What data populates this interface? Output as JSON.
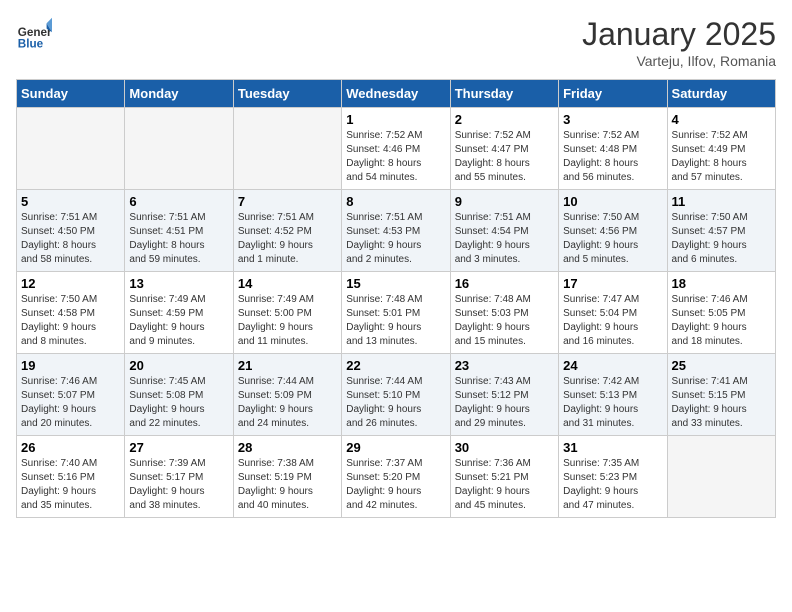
{
  "header": {
    "logo_line1": "General",
    "logo_line2": "Blue",
    "month": "January 2025",
    "location": "Varteju, Ilfov, Romania"
  },
  "weekdays": [
    "Sunday",
    "Monday",
    "Tuesday",
    "Wednesday",
    "Thursday",
    "Friday",
    "Saturday"
  ],
  "weeks": [
    [
      {
        "day": "",
        "info": ""
      },
      {
        "day": "",
        "info": ""
      },
      {
        "day": "",
        "info": ""
      },
      {
        "day": "1",
        "info": "Sunrise: 7:52 AM\nSunset: 4:46 PM\nDaylight: 8 hours\nand 54 minutes."
      },
      {
        "day": "2",
        "info": "Sunrise: 7:52 AM\nSunset: 4:47 PM\nDaylight: 8 hours\nand 55 minutes."
      },
      {
        "day": "3",
        "info": "Sunrise: 7:52 AM\nSunset: 4:48 PM\nDaylight: 8 hours\nand 56 minutes."
      },
      {
        "day": "4",
        "info": "Sunrise: 7:52 AM\nSunset: 4:49 PM\nDaylight: 8 hours\nand 57 minutes."
      }
    ],
    [
      {
        "day": "5",
        "info": "Sunrise: 7:51 AM\nSunset: 4:50 PM\nDaylight: 8 hours\nand 58 minutes."
      },
      {
        "day": "6",
        "info": "Sunrise: 7:51 AM\nSunset: 4:51 PM\nDaylight: 8 hours\nand 59 minutes."
      },
      {
        "day": "7",
        "info": "Sunrise: 7:51 AM\nSunset: 4:52 PM\nDaylight: 9 hours\nand 1 minute."
      },
      {
        "day": "8",
        "info": "Sunrise: 7:51 AM\nSunset: 4:53 PM\nDaylight: 9 hours\nand 2 minutes."
      },
      {
        "day": "9",
        "info": "Sunrise: 7:51 AM\nSunset: 4:54 PM\nDaylight: 9 hours\nand 3 minutes."
      },
      {
        "day": "10",
        "info": "Sunrise: 7:50 AM\nSunset: 4:56 PM\nDaylight: 9 hours\nand 5 minutes."
      },
      {
        "day": "11",
        "info": "Sunrise: 7:50 AM\nSunset: 4:57 PM\nDaylight: 9 hours\nand 6 minutes."
      }
    ],
    [
      {
        "day": "12",
        "info": "Sunrise: 7:50 AM\nSunset: 4:58 PM\nDaylight: 9 hours\nand 8 minutes."
      },
      {
        "day": "13",
        "info": "Sunrise: 7:49 AM\nSunset: 4:59 PM\nDaylight: 9 hours\nand 9 minutes."
      },
      {
        "day": "14",
        "info": "Sunrise: 7:49 AM\nSunset: 5:00 PM\nDaylight: 9 hours\nand 11 minutes."
      },
      {
        "day": "15",
        "info": "Sunrise: 7:48 AM\nSunset: 5:01 PM\nDaylight: 9 hours\nand 13 minutes."
      },
      {
        "day": "16",
        "info": "Sunrise: 7:48 AM\nSunset: 5:03 PM\nDaylight: 9 hours\nand 15 minutes."
      },
      {
        "day": "17",
        "info": "Sunrise: 7:47 AM\nSunset: 5:04 PM\nDaylight: 9 hours\nand 16 minutes."
      },
      {
        "day": "18",
        "info": "Sunrise: 7:46 AM\nSunset: 5:05 PM\nDaylight: 9 hours\nand 18 minutes."
      }
    ],
    [
      {
        "day": "19",
        "info": "Sunrise: 7:46 AM\nSunset: 5:07 PM\nDaylight: 9 hours\nand 20 minutes."
      },
      {
        "day": "20",
        "info": "Sunrise: 7:45 AM\nSunset: 5:08 PM\nDaylight: 9 hours\nand 22 minutes."
      },
      {
        "day": "21",
        "info": "Sunrise: 7:44 AM\nSunset: 5:09 PM\nDaylight: 9 hours\nand 24 minutes."
      },
      {
        "day": "22",
        "info": "Sunrise: 7:44 AM\nSunset: 5:10 PM\nDaylight: 9 hours\nand 26 minutes."
      },
      {
        "day": "23",
        "info": "Sunrise: 7:43 AM\nSunset: 5:12 PM\nDaylight: 9 hours\nand 29 minutes."
      },
      {
        "day": "24",
        "info": "Sunrise: 7:42 AM\nSunset: 5:13 PM\nDaylight: 9 hours\nand 31 minutes."
      },
      {
        "day": "25",
        "info": "Sunrise: 7:41 AM\nSunset: 5:15 PM\nDaylight: 9 hours\nand 33 minutes."
      }
    ],
    [
      {
        "day": "26",
        "info": "Sunrise: 7:40 AM\nSunset: 5:16 PM\nDaylight: 9 hours\nand 35 minutes."
      },
      {
        "day": "27",
        "info": "Sunrise: 7:39 AM\nSunset: 5:17 PM\nDaylight: 9 hours\nand 38 minutes."
      },
      {
        "day": "28",
        "info": "Sunrise: 7:38 AM\nSunset: 5:19 PM\nDaylight: 9 hours\nand 40 minutes."
      },
      {
        "day": "29",
        "info": "Sunrise: 7:37 AM\nSunset: 5:20 PM\nDaylight: 9 hours\nand 42 minutes."
      },
      {
        "day": "30",
        "info": "Sunrise: 7:36 AM\nSunset: 5:21 PM\nDaylight: 9 hours\nand 45 minutes."
      },
      {
        "day": "31",
        "info": "Sunrise: 7:35 AM\nSunset: 5:23 PM\nDaylight: 9 hours\nand 47 minutes."
      },
      {
        "day": "",
        "info": ""
      }
    ]
  ]
}
